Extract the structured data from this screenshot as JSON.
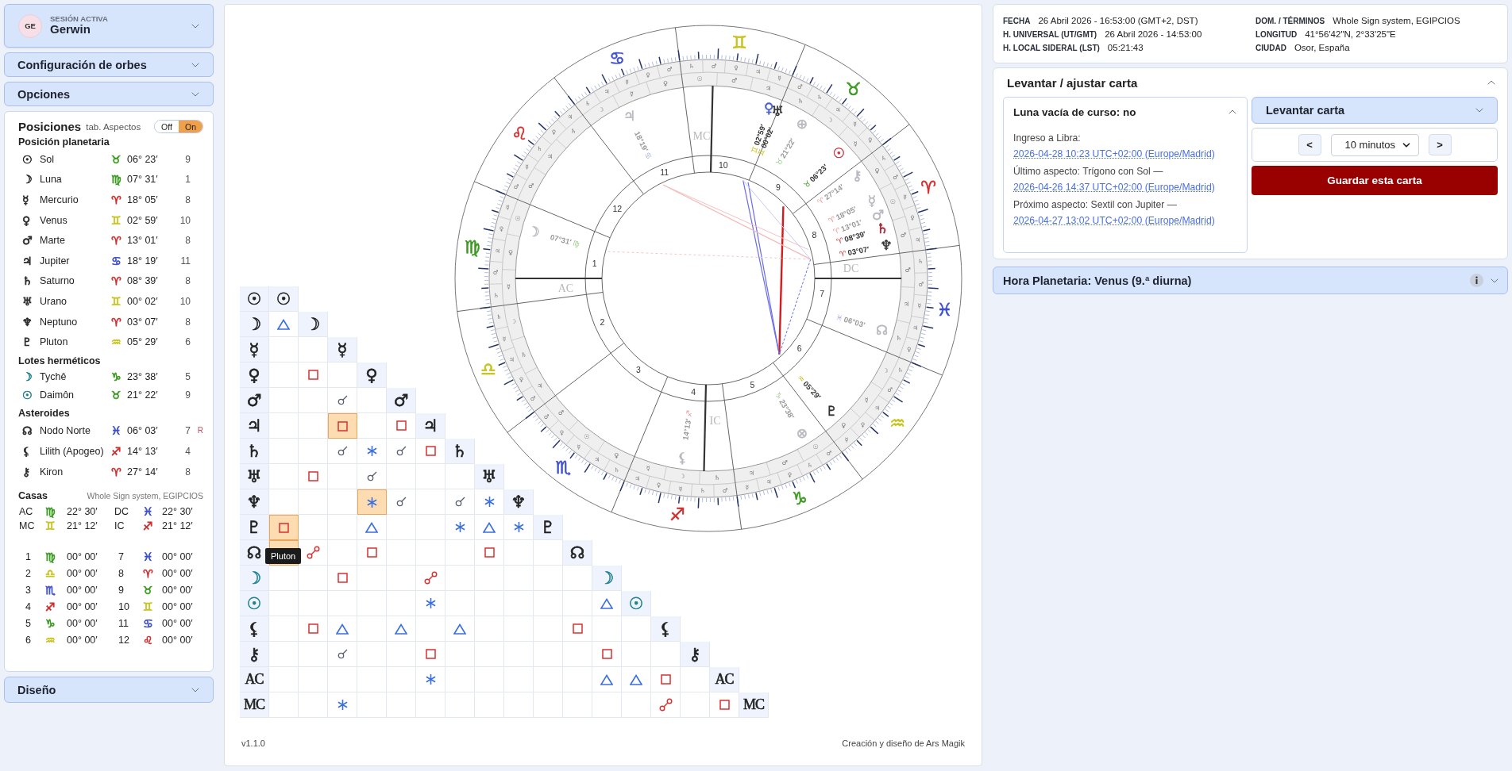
{
  "session": {
    "label": "SESIÓN ACTIVA",
    "avatar": "GE",
    "name": "Gerwin",
    "expanded": false
  },
  "sidebar_sections": [
    {
      "title": "Configuración de orbes",
      "expanded": false
    },
    {
      "title": "Opciones",
      "expanded": false
    }
  ],
  "positions": {
    "title": "Posiciones",
    "toggle_label": "tab. Aspectos",
    "toggle": [
      {
        "label": "Off",
        "selected": false
      },
      {
        "label": "On",
        "selected": true
      }
    ],
    "groups": [
      {
        "title": "Posición planetaria",
        "rows": [
          {
            "planet": {
              "glyph": "☉",
              "color": "#2b2b2b"
            },
            "name": "Sol",
            "sign": {
              "glyph": "♉",
              "color": "#3a9a1f"
            },
            "degree": "06° 23′",
            "house": "9"
          },
          {
            "planet": {
              "glyph": "☽",
              "color": "#2b2b2b"
            },
            "name": "Luna",
            "sign": {
              "glyph": "♍",
              "color": "#3a9a1f"
            },
            "degree": "07° 31′",
            "house": "1"
          },
          {
            "planet": {
              "glyph": "☿",
              "color": "#2b2b2b"
            },
            "name": "Mercurio",
            "sign": {
              "glyph": "♈",
              "color": "#d42c2c"
            },
            "degree": "18° 05′",
            "house": "8"
          },
          {
            "planet": {
              "glyph": "♀",
              "color": "#2b2b2b"
            },
            "name": "Venus",
            "sign": {
              "glyph": "♊",
              "color": "#c9c21c"
            },
            "degree": "02° 59′",
            "house": "10"
          },
          {
            "planet": {
              "glyph": "♂",
              "color": "#2b2b2b"
            },
            "name": "Marte",
            "sign": {
              "glyph": "♈",
              "color": "#d42c2c"
            },
            "degree": "13° 01′",
            "house": "8"
          },
          {
            "planet": {
              "glyph": "♃",
              "color": "#2b2b2b"
            },
            "name": "Jupiter",
            "sign": {
              "glyph": "♋",
              "color": "#3d4fd0"
            },
            "degree": "18° 19′",
            "house": "11"
          },
          {
            "planet": {
              "glyph": "♄",
              "color": "#2b2b2b"
            },
            "name": "Saturno",
            "sign": {
              "glyph": "♈",
              "color": "#d42c2c"
            },
            "degree": "08° 39′",
            "house": "8"
          },
          {
            "planet": {
              "glyph": "♅",
              "color": "#2b2b2b"
            },
            "name": "Urano",
            "sign": {
              "glyph": "♊",
              "color": "#c9c21c"
            },
            "degree": "00° 02′",
            "house": "10"
          },
          {
            "planet": {
              "glyph": "♆",
              "color": "#2b2b2b"
            },
            "name": "Neptuno",
            "sign": {
              "glyph": "♈",
              "color": "#d42c2c"
            },
            "degree": "03° 07′",
            "house": "8"
          },
          {
            "planet": {
              "glyph": "♇",
              "color": "#2b2b2b"
            },
            "name": "Pluton",
            "sign": {
              "glyph": "♒",
              "color": "#c9c21c"
            },
            "degree": "05° 29′",
            "house": "6"
          }
        ]
      },
      {
        "title": "Lotes herméticos",
        "rows": [
          {
            "planet": {
              "glyph": "☽",
              "color": "#1f8191"
            },
            "name": "Tychê",
            "sign": {
              "glyph": "♑",
              "color": "#3a9a1f"
            },
            "degree": "23° 38′",
            "house": "5"
          },
          {
            "planet": {
              "glyph": "☉",
              "color": "#1f8191"
            },
            "name": "Daimôn",
            "sign": {
              "glyph": "♉",
              "color": "#3a9a1f"
            },
            "degree": "21° 22′",
            "house": "9"
          }
        ]
      },
      {
        "title": "Asteroides",
        "rows": [
          {
            "planet": {
              "glyph": "☊",
              "color": "#2b2b2b"
            },
            "name": "Nodo Norte",
            "sign": {
              "glyph": "♓",
              "color": "#3d4fd0"
            },
            "degree": "06° 03′",
            "house": "7",
            "flag": "R"
          },
          {
            "planet": {
              "glyph": "⚸",
              "color": "#2b2b2b"
            },
            "name": "Lilith (Apogeo)",
            "sign": {
              "glyph": "♐",
              "color": "#d42c2c"
            },
            "degree": "14° 13′",
            "house": "4"
          },
          {
            "planet": {
              "glyph": "⚷",
              "color": "#2b2b2b"
            },
            "name": "Kiron",
            "sign": {
              "glyph": "♈",
              "color": "#d42c2c"
            },
            "degree": "27° 14′",
            "house": "8"
          }
        ]
      }
    ],
    "houses": {
      "title": "Casas",
      "system": "Whole Sign system, EGIPCIOS",
      "angles": [
        {
          "label": "AC",
          "sign": {
            "glyph": "♍",
            "color": "#3a9a1f"
          },
          "degree": "22° 30′"
        },
        {
          "label": "DC",
          "sign": {
            "glyph": "♓",
            "color": "#3d4fd0"
          },
          "degree": "22° 30′"
        },
        {
          "label": "MC",
          "sign": {
            "glyph": "♊",
            "color": "#c9c21c"
          },
          "degree": "21° 12′"
        },
        {
          "label": "IC",
          "sign": {
            "glyph": "♐",
            "color": "#d42c2c"
          },
          "degree": "21° 12′"
        }
      ],
      "cusps": [
        {
          "number": "1",
          "sign": {
            "glyph": "♍",
            "color": "#3a9a1f"
          },
          "degree": "00° 00′"
        },
        {
          "number": "2",
          "sign": {
            "glyph": "♎",
            "color": "#c9c21c"
          },
          "degree": "00° 00′"
        },
        {
          "number": "3",
          "sign": {
            "glyph": "♏",
            "color": "#3d4fd0"
          },
          "degree": "00° 00′"
        },
        {
          "number": "4",
          "sign": {
            "glyph": "♐",
            "color": "#d42c2c"
          },
          "degree": "00° 00′"
        },
        {
          "number": "5",
          "sign": {
            "glyph": "♑",
            "color": "#3a9a1f"
          },
          "degree": "00° 00′"
        },
        {
          "number": "6",
          "sign": {
            "glyph": "♒",
            "color": "#c9c21c"
          },
          "degree": "00° 00′"
        },
        {
          "number": "7",
          "sign": {
            "glyph": "♓",
            "color": "#3d4fd0"
          },
          "degree": "00° 00′"
        },
        {
          "number": "8",
          "sign": {
            "glyph": "♈",
            "color": "#d42c2c"
          },
          "degree": "00° 00′"
        },
        {
          "number": "9",
          "sign": {
            "glyph": "♉",
            "color": "#3a9a1f"
          },
          "degree": "00° 00′"
        },
        {
          "number": "10",
          "sign": {
            "glyph": "♊",
            "color": "#c9c21c"
          },
          "degree": "00° 00′"
        },
        {
          "number": "11",
          "sign": {
            "glyph": "♋",
            "color": "#3d4fd0"
          },
          "degree": "00° 00′"
        },
        {
          "number": "12",
          "sign": {
            "glyph": "♌",
            "color": "#d42c2c"
          },
          "degree": "00° 00′"
        }
      ]
    }
  },
  "design_section": {
    "title": "Diseño",
    "expanded": false
  },
  "wheel": {
    "signs": [
      {
        "glyph": "♍",
        "color": "#3a9a1f",
        "house_number": "1",
        "axis_label": "AC",
        "terms": [
          "☿",
          "♀",
          "♃",
          "♂",
          "♄"
        ],
        "decans": [
          "☉",
          "♀",
          "☿"
        ],
        "planets": [
          {
            "glyph": "☽",
            "color": "#b8b8c0",
            "sign_glyph": "♍",
            "degree": "07°31′",
            "faded": true
          }
        ]
      },
      {
        "glyph": "♎",
        "color": "#c9c21c",
        "house_number": "2",
        "terms": [
          "♄",
          "☿",
          "♃",
          "♀",
          "♂"
        ],
        "decans": [
          "☽",
          "♄",
          "♃"
        ]
      },
      {
        "glyph": "♏",
        "color": "#3d4fd0",
        "house_number": "3",
        "terms": [
          "♂",
          "♀",
          "☿",
          "♃",
          "♄"
        ],
        "decans": [
          "♂",
          "☉",
          "♀"
        ]
      },
      {
        "glyph": "♐",
        "color": "#d42c2c",
        "house_number": "4",
        "axis_label": "IC",
        "terms": [
          "♃",
          "♀",
          "☿",
          "♄",
          "♂"
        ],
        "decans": [
          "☿",
          "☽",
          "♄"
        ],
        "planets": [
          {
            "glyph": "⚸",
            "color": "#b8b8c0",
            "sign_glyph": "♐",
            "degree": "14°13′",
            "faded": true
          }
        ]
      },
      {
        "glyph": "♑",
        "color": "#3a9a1f",
        "house_number": "5",
        "terms": [
          "☿",
          "♃",
          "♀",
          "♄",
          "♂"
        ],
        "decans": [
          "♃",
          "♂",
          "☉"
        ],
        "planets": [
          {
            "glyph": "⊗",
            "color": "#b8b8c0",
            "sign_glyph": "♑",
            "degree": "23°38′",
            "faded": true
          }
        ]
      },
      {
        "glyph": "♒",
        "color": "#c9c21c",
        "house_number": "6",
        "terms": [
          "♄",
          "♂",
          "♃",
          "♀",
          "☿"
        ],
        "decans": [
          "☽",
          "☿",
          "♀"
        ],
        "planets": [
          {
            "glyph": "♇",
            "color": "#333333",
            "sign_glyph": "♒",
            "degree": "05°29′",
            "faded": false
          }
        ]
      },
      {
        "glyph": "♓",
        "color": "#3d4fd0",
        "house_number": "7",
        "axis_label": "DC",
        "terms": [
          "♄",
          "♂",
          "☿",
          "♃",
          "♀"
        ],
        "decans": [
          "♂",
          "♃",
          "♄"
        ],
        "planets": [
          {
            "glyph": "☊",
            "color": "#b8b8c0",
            "sign_glyph": "♓",
            "degree": "06°03′",
            "faded": true
          }
        ]
      },
      {
        "glyph": "♈",
        "color": "#d42c2c",
        "house_number": "8",
        "terms": [
          "♄",
          "♂",
          "☿",
          "♀",
          "♃"
        ],
        "decans": [
          "♀",
          "☉",
          "♂"
        ],
        "planets": [
          {
            "glyph": "♄",
            "color": "#a02030",
            "sign_glyph": "♈",
            "degree": "08°39′",
            "faded": false
          },
          {
            "glyph": "♆",
            "color": "#333333",
            "sign_glyph": "♈",
            "degree": "03°07′",
            "faded": false
          },
          {
            "glyph": "⚷",
            "color": "#b8b8c0",
            "sign_glyph": "♈",
            "degree": "27°14′",
            "faded": true
          },
          {
            "glyph": "☿",
            "color": "#b8b8c0",
            "sign_glyph": "♈",
            "degree": "18°05′",
            "faded": true
          },
          {
            "glyph": "♂",
            "color": "#b8b8c0",
            "sign_glyph": "♈",
            "degree": "13°01′",
            "faded": true
          }
        ]
      },
      {
        "glyph": "♉",
        "color": "#3a9a1f",
        "house_number": "9",
        "terms": [
          "♂",
          "♄",
          "♃",
          "☿",
          "♀"
        ],
        "decans": [
          "♄",
          "☽",
          "☿"
        ],
        "planets": [
          {
            "glyph": "☉",
            "color": "#d03040",
            "sign_glyph": "♉",
            "degree": "06°23′",
            "faded": false
          },
          {
            "glyph": "⊕",
            "color": "#b8b8c0",
            "sign_glyph": "♉",
            "degree": "21°22′",
            "faded": true
          }
        ]
      },
      {
        "glyph": "♊",
        "color": "#c9c21c",
        "house_number": "10",
        "axis_label": "MC",
        "terms": [
          "♄",
          "♂",
          "♀",
          "♃",
          "☿"
        ],
        "decans": [
          "☉",
          "♂",
          "♃"
        ],
        "planets": [
          {
            "glyph": "♀",
            "color": "#4a5fd0",
            "sign_glyph": "♊",
            "degree": "02°59′",
            "faded": false
          },
          {
            "glyph": "♅",
            "color": "#333333",
            "sign_glyph": "♊",
            "degree": "00°02′",
            "faded": false
          }
        ]
      },
      {
        "glyph": "♋",
        "color": "#3d4fd0",
        "house_number": "11",
        "terms": [
          "♄",
          "♃",
          "☿",
          "♀",
          "♂"
        ],
        "decans": [
          "☽",
          "☿",
          "♀"
        ],
        "planets": [
          {
            "glyph": "♃",
            "color": "#b8b8c0",
            "sign_glyph": "♋",
            "degree": "18°19′",
            "faded": true
          }
        ]
      },
      {
        "glyph": "♌",
        "color": "#d42c2c",
        "house_number": "12",
        "terms": [
          "♃",
          "♀",
          "♄",
          "☿",
          "♂"
        ],
        "decans": [
          "♄",
          "♃",
          "♂"
        ]
      }
    ]
  },
  "aspect_grid": {
    "tooltip": "Pluton",
    "rows": [
      {
        "glyph": "☉",
        "color": "#222222",
        "diagonal_glyph": "☉"
      },
      {
        "glyph": "☽",
        "color": "#222222",
        "diagonal_glyph": "☽",
        "cells": [
          {
            "kind": "trine",
            "highlighted": false
          }
        ]
      },
      {
        "glyph": "☿",
        "color": "#222222",
        "diagonal_glyph": "☿",
        "cells": [
          {
            "kind": "none",
            "highlighted": false
          },
          {
            "kind": "none",
            "highlighted": false
          }
        ]
      },
      {
        "glyph": "♀",
        "color": "#222222",
        "diagonal_glyph": "♀",
        "cells": [
          {
            "kind": "none",
            "highlighted": false
          },
          {
            "kind": "square",
            "highlighted": false
          },
          {
            "kind": "none",
            "highlighted": false
          }
        ]
      },
      {
        "glyph": "♂",
        "color": "#222222",
        "diagonal_glyph": "♂",
        "cells": [
          {
            "kind": "none",
            "highlighted": false
          },
          {
            "kind": "none",
            "highlighted": false
          },
          {
            "kind": "conjunction",
            "highlighted": false
          },
          {
            "kind": "none",
            "highlighted": false
          }
        ]
      },
      {
        "glyph": "♃",
        "color": "#222222",
        "diagonal_glyph": "♃",
        "cells": [
          {
            "kind": "none",
            "highlighted": false
          },
          {
            "kind": "none",
            "highlighted": false
          },
          {
            "kind": "square",
            "highlighted": true
          },
          {
            "kind": "none",
            "highlighted": false
          },
          {
            "kind": "square",
            "highlighted": false
          }
        ]
      },
      {
        "glyph": "♄",
        "color": "#222222",
        "diagonal_glyph": "♄",
        "cells": [
          {
            "kind": "none",
            "highlighted": false
          },
          {
            "kind": "none",
            "highlighted": false
          },
          {
            "kind": "conjunction",
            "highlighted": false
          },
          {
            "kind": "sextile",
            "highlighted": false
          },
          {
            "kind": "conjunction",
            "highlighted": false
          },
          {
            "kind": "square",
            "highlighted": false
          }
        ]
      },
      {
        "glyph": "♅",
        "color": "#222222",
        "diagonal_glyph": "♅",
        "cells": [
          {
            "kind": "none",
            "highlighted": false
          },
          {
            "kind": "square",
            "highlighted": false
          },
          {
            "kind": "none",
            "highlighted": false
          },
          {
            "kind": "conjunction",
            "highlighted": false
          },
          {
            "kind": "none",
            "highlighted": false
          },
          {
            "kind": "none",
            "highlighted": false
          },
          {
            "kind": "none",
            "highlighted": false
          }
        ]
      },
      {
        "glyph": "♆",
        "color": "#222222",
        "diagonal_glyph": "♆",
        "cells": [
          {
            "kind": "none",
            "highlighted": false
          },
          {
            "kind": "none",
            "highlighted": false
          },
          {
            "kind": "none",
            "highlighted": false
          },
          {
            "kind": "sextile",
            "highlighted": true
          },
          {
            "kind": "conjunction",
            "highlighted": false
          },
          {
            "kind": "none",
            "highlighted": false
          },
          {
            "kind": "conjunction",
            "highlighted": false
          },
          {
            "kind": "sextile",
            "highlighted": false
          }
        ]
      },
      {
        "glyph": "♇",
        "color": "#222222",
        "diagonal_glyph": "♇",
        "cells": [
          {
            "kind": "square",
            "highlighted": true
          },
          {
            "kind": "none",
            "highlighted": false
          },
          {
            "kind": "none",
            "highlighted": false
          },
          {
            "kind": "trine",
            "highlighted": false
          },
          {
            "kind": "none",
            "highlighted": false
          },
          {
            "kind": "none",
            "highlighted": false
          },
          {
            "kind": "sextile",
            "highlighted": false
          },
          {
            "kind": "trine",
            "highlighted": false
          },
          {
            "kind": "sextile",
            "highlighted": false
          }
        ]
      },
      {
        "glyph": "☊",
        "color": "#222222",
        "diagonal_glyph": "☊",
        "cells": [
          {
            "kind": "none",
            "highlighted": true
          },
          {
            "kind": "opposition",
            "highlighted": false
          },
          {
            "kind": "none",
            "highlighted": false
          },
          {
            "kind": "square",
            "highlighted": false
          },
          {
            "kind": "none",
            "highlighted": false
          },
          {
            "kind": "none",
            "highlighted": false
          },
          {
            "kind": "none",
            "highlighted": false
          },
          {
            "kind": "square",
            "highlighted": false
          },
          {
            "kind": "none",
            "highlighted": false
          },
          {
            "kind": "none",
            "highlighted": false
          }
        ]
      },
      {
        "glyph": "☽",
        "color": "#1f8191",
        "diagonal_glyph": "☽",
        "cells": [
          {
            "kind": "none",
            "highlighted": false
          },
          {
            "kind": "none",
            "highlighted": false
          },
          {
            "kind": "square",
            "highlighted": false
          },
          {
            "kind": "none",
            "highlighted": false
          },
          {
            "kind": "none",
            "highlighted": false
          },
          {
            "kind": "opposition",
            "highlighted": false
          },
          {
            "kind": "none",
            "highlighted": false
          },
          {
            "kind": "none",
            "highlighted": false
          },
          {
            "kind": "none",
            "highlighted": false
          },
          {
            "kind": "none",
            "highlighted": false
          },
          {
            "kind": "none",
            "highlighted": false
          }
        ]
      },
      {
        "glyph": "☉",
        "color": "#1f8191",
        "diagonal_glyph": "☉",
        "cells": [
          {
            "kind": "none",
            "highlighted": false
          },
          {
            "kind": "none",
            "highlighted": false
          },
          {
            "kind": "none",
            "highlighted": false
          },
          {
            "kind": "none",
            "highlighted": false
          },
          {
            "kind": "none",
            "highlighted": false
          },
          {
            "kind": "sextile",
            "highlighted": false
          },
          {
            "kind": "none",
            "highlighted": false
          },
          {
            "kind": "none",
            "highlighted": false
          },
          {
            "kind": "none",
            "highlighted": false
          },
          {
            "kind": "none",
            "highlighted": false
          },
          {
            "kind": "none",
            "highlighted": false
          },
          {
            "kind": "trine",
            "highlighted": false
          }
        ]
      },
      {
        "glyph": "⚸",
        "color": "#222222",
        "diagonal_glyph": "⚸",
        "cells": [
          {
            "kind": "none",
            "highlighted": false
          },
          {
            "kind": "square",
            "highlighted": false
          },
          {
            "kind": "trine",
            "highlighted": false
          },
          {
            "kind": "none",
            "highlighted": false
          },
          {
            "kind": "trine",
            "highlighted": false
          },
          {
            "kind": "none",
            "highlighted": false
          },
          {
            "kind": "trine",
            "highlighted": false
          },
          {
            "kind": "none",
            "highlighted": false
          },
          {
            "kind": "none",
            "highlighted": false
          },
          {
            "kind": "none",
            "highlighted": false
          },
          {
            "kind": "square",
            "highlighted": false
          },
          {
            "kind": "none",
            "highlighted": false
          },
          {
            "kind": "none",
            "highlighted": false
          }
        ]
      },
      {
        "glyph": "⚷",
        "color": "#222222",
        "diagonal_glyph": "⚷",
        "cells": [
          {
            "kind": "none",
            "highlighted": false
          },
          {
            "kind": "none",
            "highlighted": false
          },
          {
            "kind": "conjunction",
            "highlighted": false
          },
          {
            "kind": "none",
            "highlighted": false
          },
          {
            "kind": "none",
            "highlighted": false
          },
          {
            "kind": "square",
            "highlighted": false
          },
          {
            "kind": "none",
            "highlighted": false
          },
          {
            "kind": "none",
            "highlighted": false
          },
          {
            "kind": "none",
            "highlighted": false
          },
          {
            "kind": "none",
            "highlighted": false
          },
          {
            "kind": "none",
            "highlighted": false
          },
          {
            "kind": "square",
            "highlighted": false
          },
          {
            "kind": "none",
            "highlighted": false
          },
          {
            "kind": "none",
            "highlighted": false
          }
        ]
      },
      {
        "glyph": "AC",
        "color": "#222222",
        "diagonal_glyph": "AC",
        "cells": [
          {
            "kind": "none",
            "highlighted": false
          },
          {
            "kind": "none",
            "highlighted": false
          },
          {
            "kind": "none",
            "highlighted": false
          },
          {
            "kind": "none",
            "highlighted": false
          },
          {
            "kind": "none",
            "highlighted": false
          },
          {
            "kind": "sextile",
            "highlighted": false
          },
          {
            "kind": "none",
            "highlighted": false
          },
          {
            "kind": "none",
            "highlighted": false
          },
          {
            "kind": "none",
            "highlighted": false
          },
          {
            "kind": "none",
            "highlighted": false
          },
          {
            "kind": "none",
            "highlighted": false
          },
          {
            "kind": "trine",
            "highlighted": false
          },
          {
            "kind": "trine",
            "highlighted": false
          },
          {
            "kind": "square",
            "highlighted": false
          },
          {
            "kind": "none",
            "highlighted": false
          }
        ]
      },
      {
        "glyph": "MC",
        "color": "#222222",
        "diagonal_glyph": "MC",
        "cells": [
          {
            "kind": "none",
            "highlighted": false
          },
          {
            "kind": "none",
            "highlighted": false
          },
          {
            "kind": "sextile",
            "highlighted": false
          },
          {
            "kind": "none",
            "highlighted": false
          },
          {
            "kind": "none",
            "highlighted": false
          },
          {
            "kind": "none",
            "highlighted": false
          },
          {
            "kind": "none",
            "highlighted": false
          },
          {
            "kind": "none",
            "highlighted": false
          },
          {
            "kind": "none",
            "highlighted": false
          },
          {
            "kind": "none",
            "highlighted": false
          },
          {
            "kind": "none",
            "highlighted": false
          },
          {
            "kind": "none",
            "highlighted": false
          },
          {
            "kind": "none",
            "highlighted": false
          },
          {
            "kind": "opposition",
            "highlighted": false
          },
          {
            "kind": "none",
            "highlighted": false
          },
          {
            "kind": "square",
            "highlighted": false
          }
        ]
      }
    ]
  },
  "footer": {
    "version": "v1.1.0",
    "credit": "Creación y diseño de Ars Magik"
  },
  "chart_info": {
    "left": [
      {
        "label": "FECHA",
        "value": "26 Abril 2026 - 16:53:00 (GMT+2, DST)"
      },
      {
        "label": "H. UNIVERSAL (UT/GMT)",
        "value": "26 Abril 2026 - 14:53:00"
      },
      {
        "label": "H. LOCAL SIDERAL (LST)",
        "value": "05:21:43"
      }
    ],
    "right": [
      {
        "label": "DOM. / TÉRMINOS",
        "value": "Whole Sign system, EGIPCIOS"
      },
      {
        "label": "LONGITUD",
        "value": "41°56'42\"N, 2°33'25\"E"
      },
      {
        "label": "CIUDAD",
        "value": "Osor, España"
      }
    ]
  },
  "cast_chart": {
    "title": "Levantar / ajustar carta",
    "expanded": true,
    "void_moon": {
      "title": "Luna vacía de curso: no",
      "expanded": true,
      "entries": [
        {
          "text": "Ingreso a Libra:",
          "link": "2026-04-28 10:23 UTC+02:00 (Europe/Madrid)"
        },
        {
          "text": "Último aspecto: Trígono con Sol —",
          "link": "2026-04-26 14:37 UTC+02:00 (Europe/Madrid)"
        },
        {
          "text": "Próximo aspecto: Sextil con Jupiter —",
          "link": "2026-04-27 13:02 UTC+02:00 (Europe/Madrid)"
        }
      ]
    },
    "cast": {
      "title": "Levantar carta",
      "expanded": false,
      "prev": "<",
      "step": "10 minutos",
      "next": ">",
      "save": "Guardar esta carta"
    }
  },
  "planetary_hour": {
    "title": "Hora Planetaria: Venus (9.ª diurna)",
    "expanded": false
  }
}
